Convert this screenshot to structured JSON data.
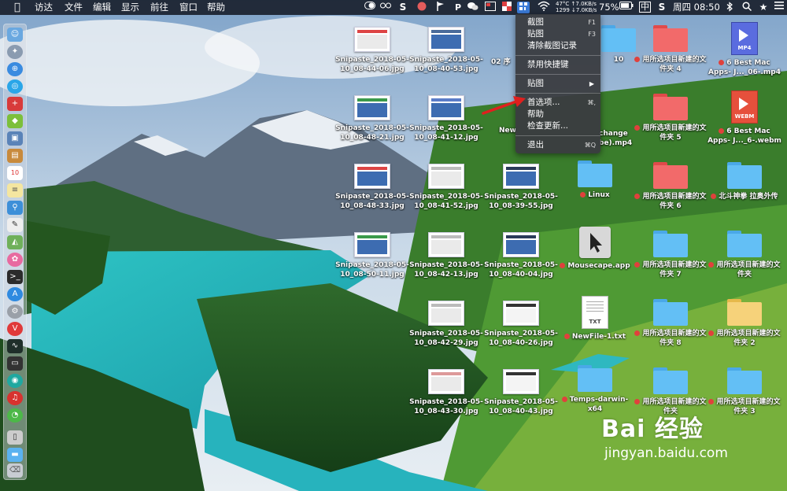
{
  "menubar": {
    "apple": "",
    "app_menus": [
      "访达",
      "文件",
      "编辑",
      "显示",
      "前往",
      "窗口",
      "帮助"
    ],
    "network_up": "47°C ↑7.0KB/s",
    "network_down": "1299 ↓7.0KB/s",
    "battery": "75%",
    "input_method": "中",
    "clock": "周四 08:50"
  },
  "snip_menu": {
    "items": [
      {
        "label": "截图",
        "shortcut": "F1"
      },
      {
        "label": "贴图",
        "shortcut": "F3"
      },
      {
        "label": "清除截图记录",
        "shortcut": ""
      },
      {
        "label": "禁用快捷键",
        "shortcut": ""
      },
      {
        "label": "贴图",
        "shortcut": "▶"
      },
      {
        "label": "首选项...",
        "shortcut": "⌘,"
      },
      {
        "label": "帮助",
        "shortcut": ""
      },
      {
        "label": "检查更新...",
        "shortcut": ""
      },
      {
        "label": "退出",
        "shortcut": "⌘Q"
      }
    ]
  },
  "desktop": {
    "col1": [
      {
        "name": "Snipaste_2018-05-10_08-44-06.jpg",
        "kind": "white"
      },
      {
        "name": "Snipaste_2018-05-10_08-48-21.jpg",
        "kind": "desk"
      },
      {
        "name": "Snipaste_2018-05-10_08-48-33.jpg",
        "kind": "desk"
      },
      {
        "name": "Snipaste_2018-05-10_08-50-11.jpg",
        "kind": "desk"
      }
    ],
    "col2": [
      {
        "name": "Snipaste_2018-05-10_08-40-53.jpg",
        "kind": "desk"
      },
      {
        "name": "Snipaste_2018-05-10_08-41-12.jpg",
        "kind": "desk"
      },
      {
        "name": "Snipaste_2018-05-10_08-41-52.jpg",
        "kind": "white"
      },
      {
        "name": "Snipaste_2018-05-10_08-42-13.jpg",
        "kind": "white"
      },
      {
        "name": "Snipaste_2018-05-10_08-42-29.jpg",
        "kind": "white"
      },
      {
        "name": "Snipaste_2018-05-10_08-43-30.jpg",
        "kind": "white"
      }
    ],
    "col3": [
      {
        "name": "02 序"
      },
      {
        "name": "New"
      },
      {
        "name": "Snipaste_2018-05-10_08-39-55.jpg",
        "kind": "desk"
      },
      {
        "name": "Snipaste_2018-05-10_08-40-04.jpg",
        "kind": "desk"
      },
      {
        "name": "Snipaste_2018-05-10_08-40-26.jpg",
        "kind": "white"
      },
      {
        "name": "Snipaste_2018-05-10_08-40-43.jpg",
        "kind": "white"
      }
    ],
    "col4": [
      {
        "name": "10"
      },
      {
        "name": "change\nbe).mp4"
      },
      {
        "name": "Linux"
      },
      {
        "name": "Mousecape.app"
      },
      {
        "name": "NewFile-1.txt"
      },
      {
        "name": "Temps-darwin-x64"
      }
    ],
    "col5": [
      {
        "name": "用所选项目新建的文件夹 4"
      },
      {
        "name": "用所选项目新建的文件夹 5"
      },
      {
        "name": "用所选项目新建的文件夹 6"
      },
      {
        "name": "用所选项目新建的文件夹 7"
      },
      {
        "name": "用所选项目新建的文件夹 8"
      },
      {
        "name": "用所选项目新建的文件夹"
      }
    ],
    "col6": [
      {
        "name": "6 Best Mac Apps- J..._06-.mp4",
        "tag": "MP4"
      },
      {
        "name": "6 Best Mac Apps- J..._6-.webm",
        "tag": "WEBM"
      },
      {
        "name": "北斗神拳 拉奥外传"
      },
      {
        "name": "用所选项目新建的文件夹"
      },
      {
        "name": "用所选项目新建的文件夹 2"
      },
      {
        "name": "用所选项目新建的文件夹 3"
      }
    ]
  },
  "file_tags": {
    "txt": "TXT"
  },
  "watermark": {
    "brand": "Bai 经验",
    "url": "jingyan.baidu.com"
  }
}
